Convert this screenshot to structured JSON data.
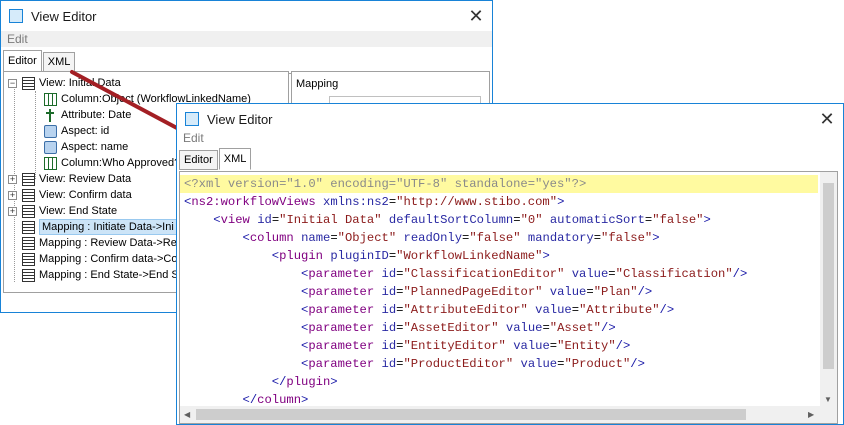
{
  "back_window": {
    "title": "View Editor",
    "menu": "Edit",
    "tabs": [
      "Editor",
      "XML"
    ],
    "mapping_label": "Mapping",
    "tree": [
      {
        "label": "View: Initial Data",
        "icon": "view-icon"
      },
      {
        "label": "Column:Object (WorkflowLinkedName)",
        "icon": "column-icon"
      },
      {
        "label": "Attribute: Date",
        "icon": "attribute-icon"
      },
      {
        "label": "Aspect: id",
        "icon": "aspect-icon"
      },
      {
        "label": "Aspect: name",
        "icon": "aspect-icon"
      },
      {
        "label": "Column:Who Approved?",
        "icon": "column-icon"
      },
      {
        "label": "View: Review Data",
        "icon": "view-icon"
      },
      {
        "label": "View: Confirm data",
        "icon": "view-icon"
      },
      {
        "label": "View: End State",
        "icon": "view-icon"
      },
      {
        "label": "Mapping : Initiate Data->Ini",
        "icon": "mapping-icon"
      },
      {
        "label": "Mapping : Review Data->Re",
        "icon": "mapping-icon"
      },
      {
        "label": "Mapping : Confirm data->Co",
        "icon": "mapping-icon"
      },
      {
        "label": "Mapping : End State->End S",
        "icon": "mapping-icon"
      }
    ]
  },
  "front_window": {
    "title": "View Editor",
    "menu": "Edit",
    "tabs": [
      "Editor",
      "XML"
    ],
    "xml_lines": [
      "<?xml version=\"1.0\" encoding=\"UTF-8\" standalone=\"yes\"?>",
      "<ns2:workflowViews xmlns:ns2=\"http://www.stibo.com\">",
      "    <view id=\"Initial Data\" defaultSortColumn=\"0\" automaticSort=\"false\">",
      "        <column name=\"Object\" readOnly=\"false\" mandatory=\"false\">",
      "            <plugin pluginID=\"WorkflowLinkedName\">",
      "                <parameter id=\"ClassificationEditor\" value=\"Classification\"/>",
      "                <parameter id=\"PlannedPageEditor\" value=\"Plan\"/>",
      "                <parameter id=\"AttributeEditor\" value=\"Attribute\"/>",
      "                <parameter id=\"AssetEditor\" value=\"Asset\"/>",
      "                <parameter id=\"EntityEditor\" value=\"Entity\"/>",
      "                <parameter id=\"ProductEditor\" value=\"Product\"/>",
      "            </plugin>",
      "        </column>"
    ]
  },
  "colors": {
    "window_border": "#1883d7",
    "highlight_line": "#fffaa0",
    "annotation_arrow": "#a31f24"
  }
}
